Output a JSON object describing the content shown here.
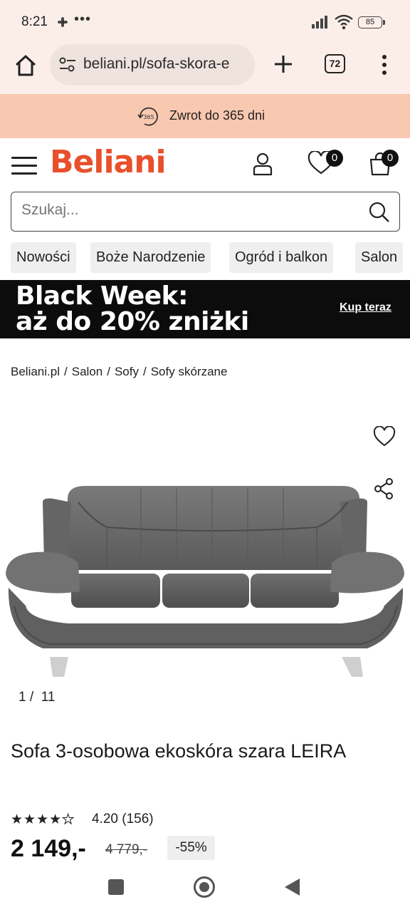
{
  "status_bar": {
    "time": "8:21",
    "dots": "•••",
    "battery": "85"
  },
  "browser": {
    "url": "beliani.pl/sofa-skora-e",
    "tab_count": "72"
  },
  "promo": {
    "icon_label": "365",
    "text": "Zwrot do 365 dni"
  },
  "header": {
    "logo": "Beliani",
    "wishlist_count": "0",
    "cart_count": "0"
  },
  "search": {
    "placeholder": "Szukaj..."
  },
  "categories": [
    "Nowości",
    "Boże Narodzenie",
    "Ogród i balkon",
    "Salon"
  ],
  "banner": {
    "line1": "Black Week:",
    "line2": "aż do 20% zniżki",
    "cta": "Kup teraz"
  },
  "breadcrumb": [
    "Beliani.pl",
    "Salon",
    "Sofy",
    "Sofy skórzane"
  ],
  "gallery": {
    "current": "1",
    "total": "11"
  },
  "product": {
    "title": "Sofa 3-osobowa ekoskóra szara LEIRA",
    "rating_value": "4.20",
    "rating_count": "(156)",
    "stars_filled": 4,
    "price": "2 149,-",
    "old_price": "4 779,-",
    "discount": "-55%"
  },
  "colors": {
    "brand": "#e8502b",
    "promo_bg": "#f9c8b0",
    "banner_bg": "#0c0c0c",
    "sofa": "#6b6b6b"
  }
}
